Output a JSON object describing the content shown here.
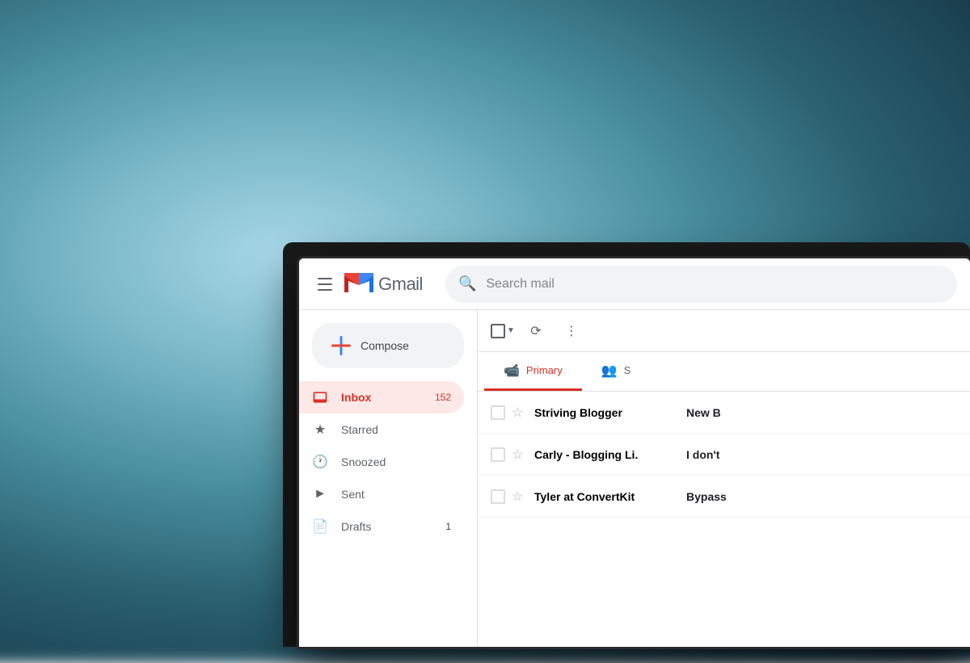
{
  "background": {
    "description": "blurred ocean/teal background"
  },
  "topbar": {
    "app_name": "Gmail",
    "search_placeholder": "Search mail"
  },
  "compose": {
    "label": "Compose"
  },
  "sidebar": {
    "items": [
      {
        "id": "inbox",
        "label": "Inbox",
        "count": "152",
        "active": true
      },
      {
        "id": "starred",
        "label": "Starred",
        "count": "",
        "active": false
      },
      {
        "id": "snoozed",
        "label": "Snoozed",
        "count": "",
        "active": false
      },
      {
        "id": "sent",
        "label": "Sent",
        "count": "",
        "active": false
      },
      {
        "id": "drafts",
        "label": "Drafts",
        "count": "1",
        "active": false
      }
    ]
  },
  "tabs": [
    {
      "id": "primary",
      "label": "Primary",
      "active": true
    },
    {
      "id": "social",
      "label": "S",
      "active": false
    }
  ],
  "emails": [
    {
      "sender": "Striving Blogger",
      "subject": "New B",
      "time": ""
    },
    {
      "sender": "Carly - Blogging Li.",
      "subject": "I don't",
      "time": ""
    },
    {
      "sender": "Tyler at ConvertKit",
      "subject": "Bypass",
      "time": ""
    }
  ]
}
